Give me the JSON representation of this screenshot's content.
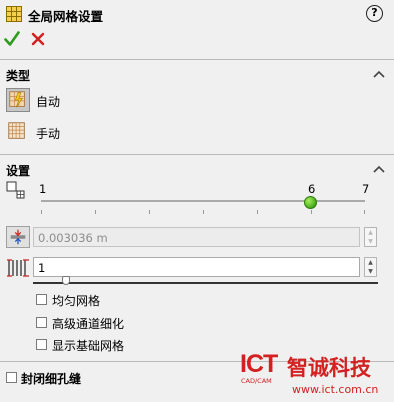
{
  "title_bar": {
    "title": "全局网格设置",
    "help_glyph": "?"
  },
  "actions": {
    "ok_icon": "checkmark-icon",
    "cancel_icon": "close-icon"
  },
  "colors": {
    "ok": "#2e9c1c",
    "cancel": "#d21f1f",
    "slider_thumb": "#4cb01c"
  },
  "type_section": {
    "title": "类型",
    "options": [
      {
        "label": "自动",
        "icon": "auto-mesh-icon",
        "selected": true
      },
      {
        "label": "手动",
        "icon": "manual-mesh-icon",
        "selected": false
      }
    ]
  },
  "settings_section": {
    "title": "设置",
    "level_slider": {
      "min": "1",
      "max": "7",
      "current": "6",
      "value": 6,
      "min_value": 1,
      "max_value": 7
    },
    "min_gap": {
      "value": "0.003036 m",
      "disabled": true
    },
    "cells_count": {
      "value": "1"
    },
    "checkboxes": [
      {
        "label": "均匀网格",
        "checked": false
      },
      {
        "label": "高级通道细化",
        "checked": false
      },
      {
        "label": "显示基础网格",
        "checked": false
      }
    ]
  },
  "close_thin_slots": {
    "label": "封闭细孔缝",
    "checked": false
  },
  "watermark": {
    "brand": "ICT",
    "sub": "CAD/CAM",
    "name": "智诚科技",
    "url": "www.ict.com.cn"
  }
}
